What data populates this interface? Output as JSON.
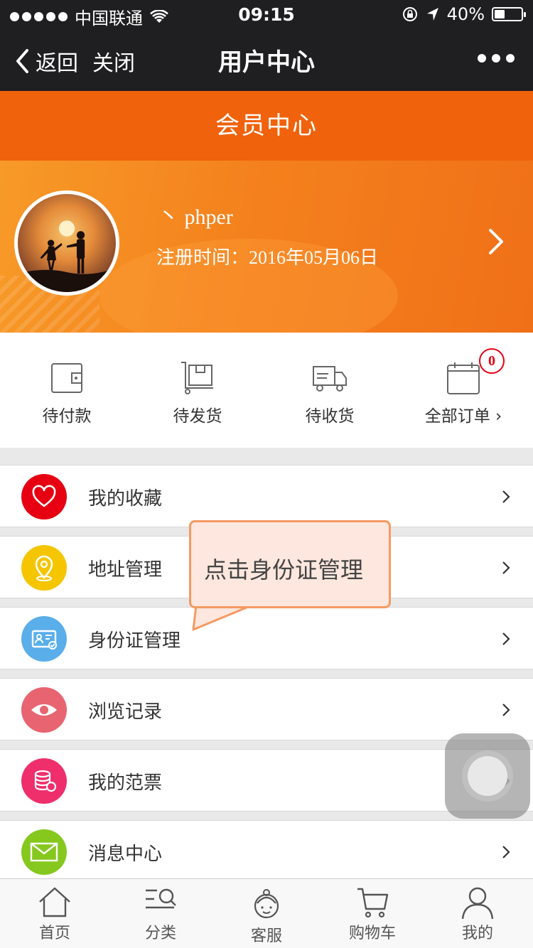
{
  "status": {
    "carrier": "中国联通",
    "time": "09:15",
    "battery": "40%"
  },
  "nav": {
    "back": "返回",
    "close": "关闭",
    "title": "用户中心"
  },
  "header": {
    "title": "会员中心"
  },
  "profile": {
    "username": "丶 phper",
    "reg_date": "注册时间：2016年05月06日"
  },
  "orders": {
    "items": [
      {
        "label": "待付款",
        "icon": "wallet-icon"
      },
      {
        "label": "待发货",
        "icon": "package-cart-icon"
      },
      {
        "label": "待收货",
        "icon": "truck-icon"
      },
      {
        "label": "全部订单 ›",
        "icon": "calendar-icon"
      }
    ],
    "badge": "0"
  },
  "menu": {
    "items": [
      {
        "label": "我的收藏",
        "icon": "heart-icon",
        "color": "#e60012"
      },
      {
        "label": "地址管理",
        "icon": "location-pin-icon",
        "color": "#f5c500"
      },
      {
        "label": "身份证管理",
        "icon": "id-card-icon",
        "color": "#5aaeea"
      },
      {
        "label": "浏览记录",
        "icon": "eye-icon",
        "color": "#e86470"
      },
      {
        "label": "我的范票",
        "icon": "coins-icon",
        "color": "#ee2f6b"
      },
      {
        "label": "消息中心",
        "icon": "mail-icon",
        "color": "#86c81e"
      }
    ]
  },
  "tooltip": {
    "text": "点击身份证管理"
  },
  "tabbar": {
    "items": [
      {
        "label": "首页",
        "icon": "home-icon"
      },
      {
        "label": "分类",
        "icon": "category-search-icon"
      },
      {
        "label": "客服",
        "icon": "customer-service-icon"
      },
      {
        "label": "购物车",
        "icon": "cart-icon"
      },
      {
        "label": "我的",
        "icon": "user-icon"
      }
    ]
  },
  "colors": {
    "brand_orange": "#f0620b",
    "nav_dark": "#1f1f21",
    "badge_red": "#e60012"
  }
}
